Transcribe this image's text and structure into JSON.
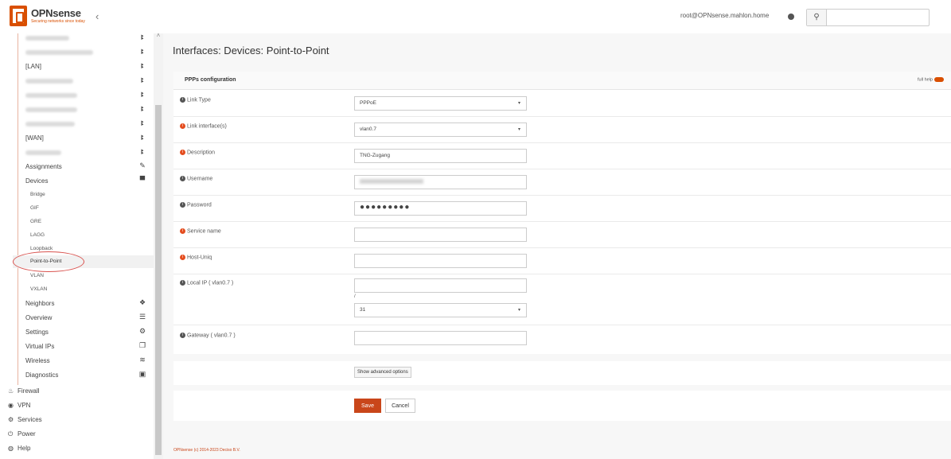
{
  "header": {
    "logo_text": "OPNsense",
    "logo_sub": "Securing networks since today",
    "user": "root@OPNsense.mahlon.home"
  },
  "sidebar": {
    "items": [
      {
        "label": "[LAN]"
      },
      {
        "label": "[WAN]"
      },
      {
        "label": "Assignments"
      },
      {
        "label": "Devices"
      },
      {
        "label": "Neighbors"
      },
      {
        "label": "Overview"
      },
      {
        "label": "Settings"
      },
      {
        "label": "Virtual IPs"
      },
      {
        "label": "Wireless"
      },
      {
        "label": "Diagnostics"
      }
    ],
    "device_subitems": [
      {
        "label": "Bridge"
      },
      {
        "label": "GIF"
      },
      {
        "label": "GRE"
      },
      {
        "label": "LAGG"
      },
      {
        "label": "Loopback"
      },
      {
        "label": "Point-to-Point"
      },
      {
        "label": "VLAN"
      },
      {
        "label": "VXLAN"
      }
    ],
    "top_sections": [
      {
        "label": "Firewall"
      },
      {
        "label": "VPN"
      },
      {
        "label": "Services"
      },
      {
        "label": "Power"
      },
      {
        "label": "Help"
      }
    ]
  },
  "main": {
    "page_title": "Interfaces: Devices: Point-to-Point",
    "panel_title": "PPPs configuration",
    "full_help": "full help",
    "form": {
      "link_type": {
        "label": "Link Type",
        "value": "PPPoE"
      },
      "link_interface": {
        "label": "Link interface(s)",
        "value": "vlan0.7"
      },
      "description": {
        "label": "Description",
        "value": "TNG-Zugang"
      },
      "username": {
        "label": "Username"
      },
      "password": {
        "label": "Password",
        "value": "●●●●●●●●●"
      },
      "service_name": {
        "label": "Service name",
        "value": ""
      },
      "host_uniq": {
        "label": "Host-Uniq",
        "value": ""
      },
      "local_ip": {
        "label": "Local IP ( vlan0.7 )",
        "value": "",
        "separator": "/",
        "subnet": "31"
      },
      "gateway": {
        "label": "Gateway ( vlan0.7 )",
        "value": ""
      }
    },
    "advanced_button": "Show advanced options",
    "save_button": "Save",
    "cancel_button": "Cancel",
    "footer": "OPNsense (c) 2014-2023 Deciso B.V."
  },
  "colors": {
    "accent": "#d94f00",
    "save": "#c9461a",
    "annotation_circle": "#d9534f"
  }
}
